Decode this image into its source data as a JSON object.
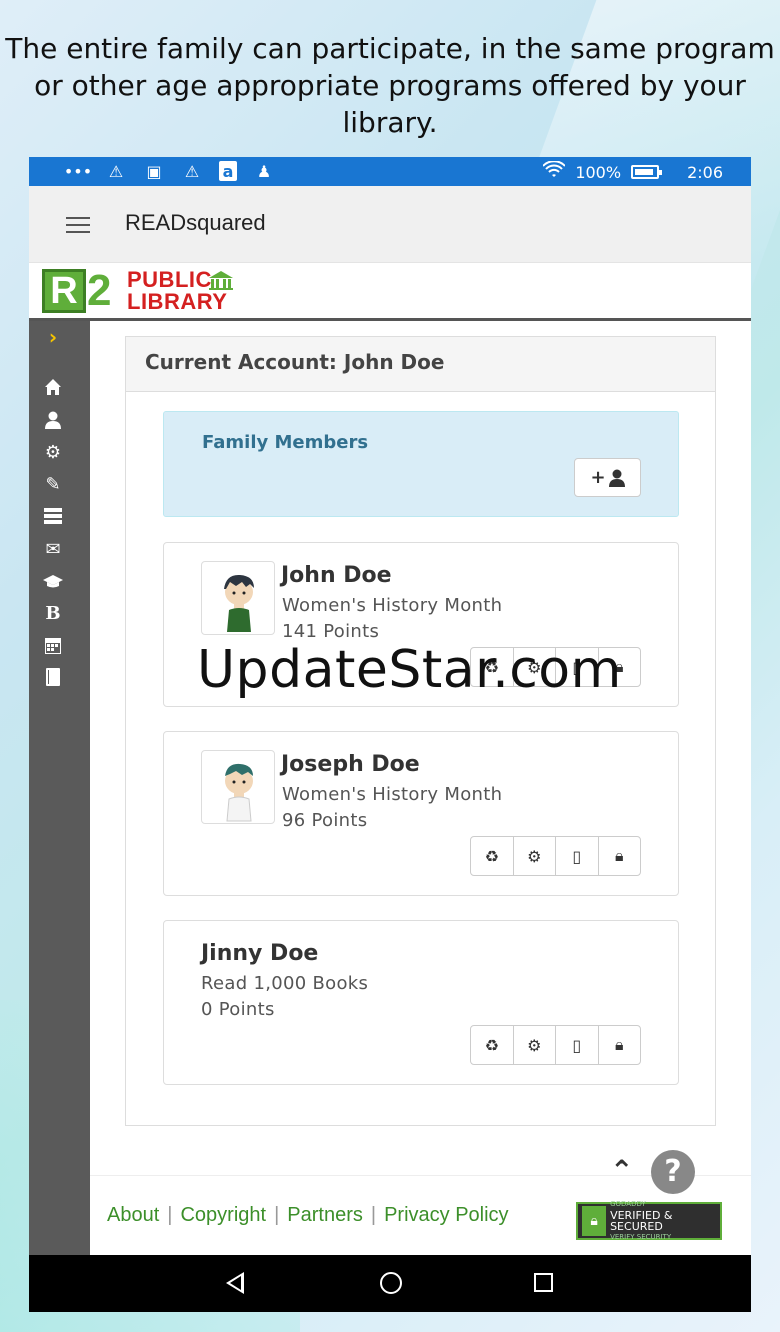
{
  "caption": "The entire family can participate, in the same program or other age appropriate programs offered by your library.",
  "statusbar": {
    "left_icons": [
      "more-icon",
      "warning-icon",
      "image-icon",
      "warning-icon",
      "amazon-icon",
      "android-icon"
    ],
    "battery": "100%",
    "time": "2:06"
  },
  "appbar": {
    "title": "READsquared"
  },
  "logo": {
    "line1": "PUBLIC",
    "line2": "LIBRARY"
  },
  "panel": {
    "title": "Current Account: John Doe"
  },
  "family": {
    "title": "Family Members"
  },
  "members": [
    {
      "name": "John Doe",
      "program": "Women's History Month",
      "points": "141 Points"
    },
    {
      "name": "Joseph Doe",
      "program": "Women's History Month",
      "points": "96 Points"
    },
    {
      "name": "Jinny Doe",
      "program": "Read 1,000 Books",
      "points": "0 Points"
    }
  ],
  "footer": {
    "links": [
      "About",
      "Copyright",
      "Partners",
      "Privacy Policy"
    ],
    "badge_top": "GODADDY",
    "badge_main": "VERIFIED & SECURED",
    "badge_sub": "VERIFY SECURITY"
  },
  "watermark": "UpdateStar.com"
}
